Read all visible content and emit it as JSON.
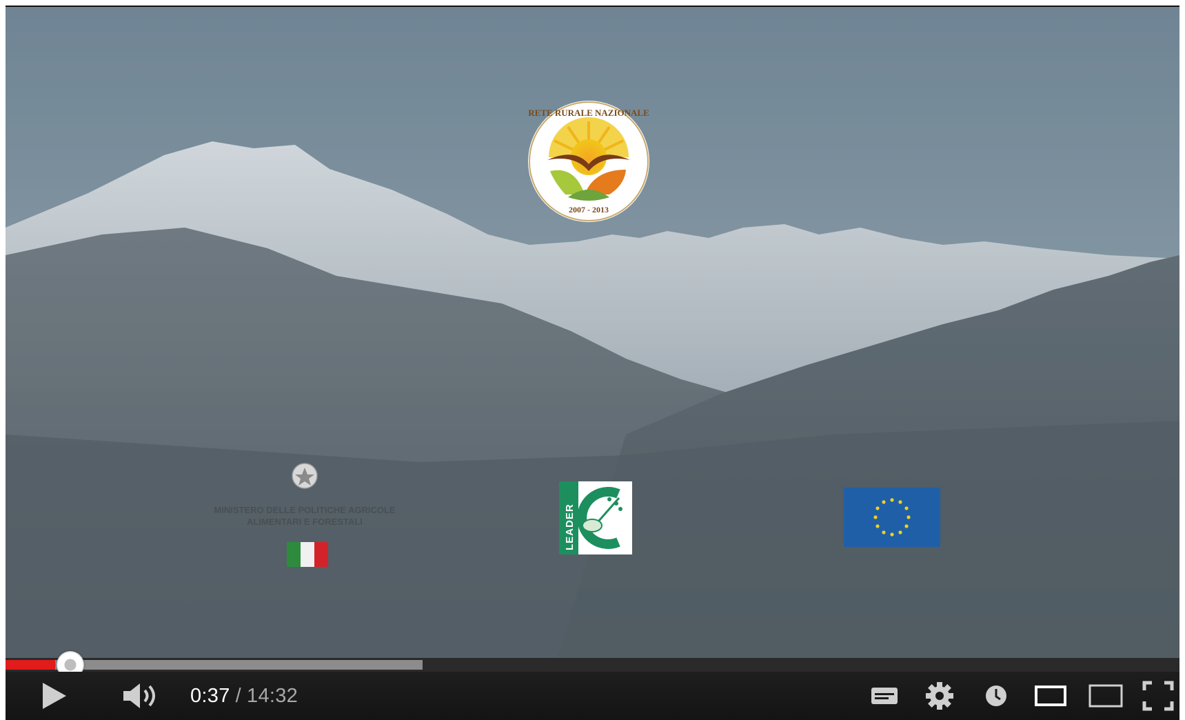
{
  "video": {
    "description_free": true,
    "logos": {
      "rrn": {
        "name": "rete-rurale-nazionale-logo",
        "text_arc": "RETE RURALE NAZIONALE",
        "years": "2007 - 2013"
      },
      "ministry": {
        "name": "ministero-logo",
        "line1": "MINISTERO DELLE POLITICHE AGRICOLE",
        "line2": "ALIMENTARI E FORESTALI"
      },
      "leader": {
        "name": "leader-logo",
        "text": "LEADER"
      },
      "eu": {
        "name": "eu-flag"
      }
    }
  },
  "player": {
    "current_time": "0:37",
    "separator": "/",
    "duration": "14:32",
    "progress_fraction": 0.0425,
    "buffered_fraction": 0.355,
    "colors": {
      "played": "#e21b1b",
      "buffered": "#8c8c8c",
      "track": "#2a2a2a",
      "controls_bg": "#1a1a1a",
      "icon": "#cccccc"
    },
    "controls": {
      "play": "play-icon",
      "volume": "volume-icon",
      "captions": "captions-icon",
      "settings": "gear-icon",
      "watch_later": "clock-icon",
      "small_player": "small-player-icon",
      "large_player": "large-player-icon",
      "fullscreen": "fullscreen-icon"
    }
  }
}
